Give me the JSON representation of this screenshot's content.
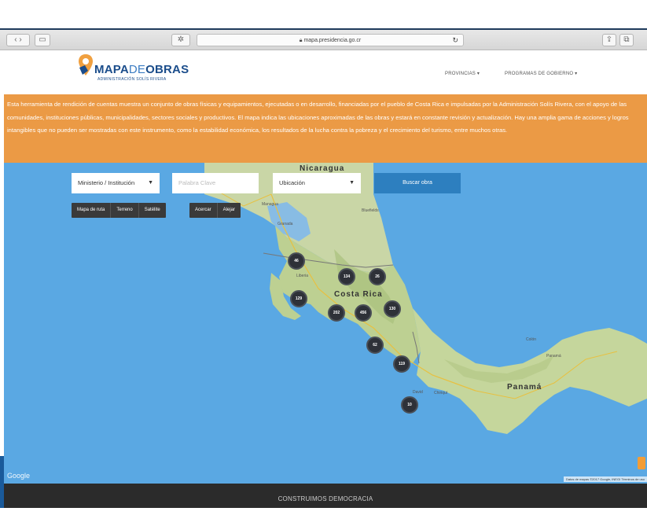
{
  "browser": {
    "url": "mapa.presidencia.go.cr",
    "back_icon": "chevron-left-icon",
    "forward_icon": "chevron-right-icon",
    "sidebar_icon": "sidebar-icon",
    "reload_icon": "reload-icon",
    "share_icon": "share-icon",
    "tabs_icon": "tabs-icon"
  },
  "site": {
    "logo_title_part1": "MAPA",
    "logo_title_part2": "DE",
    "logo_title_part3": "OBRAS",
    "logo_subtitle": "ADMINISTRACIÓN SOLÍS RIVERA",
    "nav": [
      {
        "label": "PROVINCIAS ▾"
      },
      {
        "label": "PROGRAMAS DE GOBIERNO ▾"
      }
    ]
  },
  "banner": {
    "text": "Esta herramienta de rendición de cuentas muestra un conjunto de obras físicas y equipamientos, ejecutadas o en desarrollo, financiadas por el pueblo de Costa Rica e impulsadas por la Administración Solís Rivera, con el apoyo de las comunidades, instituciones públicas, municipalidades, sectores sociales y productivos. El mapa indica las ubicaciones aproximadas de las obras y estará en constante revisión y actualización. Hay una amplia gama de acciones y logros intangibles que no pueden ser mostradas con este instrumento, como la estabilidad económica, los resultados de la lucha contra la pobreza y el crecimiento del turismo, entre muchos otras.",
    "bg_color": "#eb9a45"
  },
  "filters": {
    "institution": "Ministerio / Institución",
    "keyword_placeholder": "Palabra Clave",
    "location": "Ubicación",
    "search_button": "Buscar obra"
  },
  "map_controls": {
    "type_buttons": [
      "Mapa de ruta",
      "Terreno",
      "Satélite"
    ],
    "zoom_buttons": [
      "Acercar",
      "Alejar"
    ]
  },
  "map": {
    "labels": {
      "nicaragua": "Nicaragua",
      "costa_rica": "Costa Rica",
      "panama": "Panamá",
      "managua": "Managua",
      "bluefields": "Bluefields",
      "granada": "Granada",
      "liberia": "Liberia",
      "colon": "Colón",
      "panama_city": "Panamá",
      "david": "David",
      "chiriqui": "Chiriquí"
    },
    "clusters": [
      "46",
      "134",
      "26",
      "129",
      "Costa Rica",
      "202",
      "456",
      "130",
      "62",
      "119",
      "10"
    ],
    "google": "Google",
    "attribution": "Datos de mapas ©2017 Google, INEGI   Términos de uso"
  },
  "footer": {
    "text": "CONSTRUIMOS DEMOCRACIA"
  }
}
